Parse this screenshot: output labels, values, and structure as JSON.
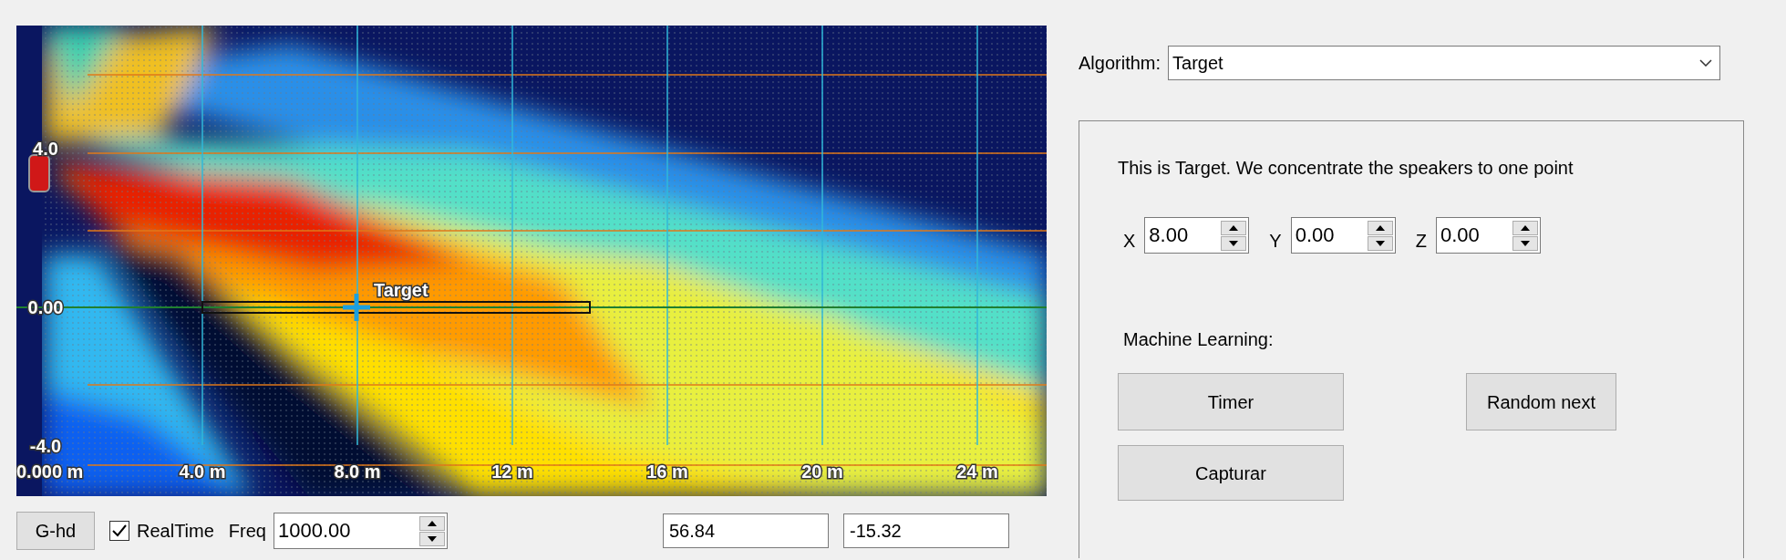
{
  "plot": {
    "y_labels": [
      "4.0",
      "0.00",
      "-4.0"
    ],
    "x_labels": [
      "0.000 m",
      "4.0 m",
      "8.0 m",
      "12 m",
      "16 m",
      "20 m",
      "24 m"
    ],
    "target_label": "Target"
  },
  "bottom_bar": {
    "button": "G-hd",
    "realtime": {
      "label": "RealTime",
      "checked": true
    },
    "freq": {
      "label": "Freq",
      "value": "1000.00"
    },
    "readouts": [
      "56.84",
      "-15.32"
    ]
  },
  "algorithm": {
    "label": "Algorithm:",
    "value": "Target"
  },
  "panel": {
    "description": "This is Target. We concentrate the speakers to one point",
    "coords": [
      {
        "label": "X",
        "value": "8.00"
      },
      {
        "label": "Y",
        "value": "0.00"
      },
      {
        "label": "Z",
        "value": "0.00"
      }
    ],
    "ml_label": "Machine Learning:",
    "buttons": [
      "Timer",
      "Random next",
      "Capturar"
    ]
  }
}
